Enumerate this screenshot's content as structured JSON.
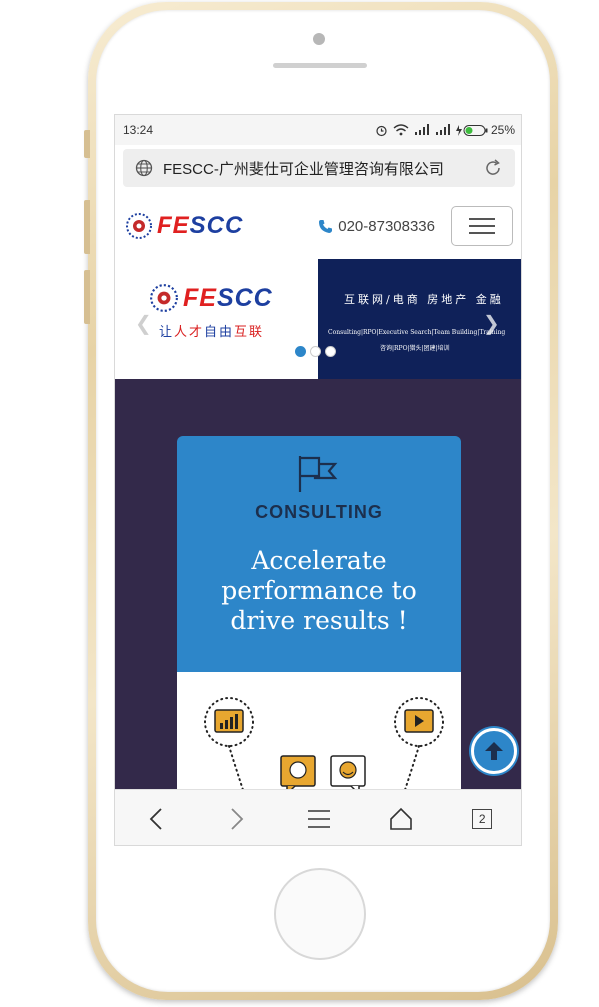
{
  "statusbar": {
    "time": "13:24",
    "battery": "25%"
  },
  "browser": {
    "page_title": "FESCC-广州斐仕可企业管理咨询有限公司",
    "tab_count": "2"
  },
  "header": {
    "logo_text_red": "FE",
    "logo_text_blue": "SCC",
    "phone": "020-87308336"
  },
  "banner": {
    "logo_red": "FE",
    "logo_blue": "SCC",
    "slogan_blue_1": "让",
    "slogan_red_1": "人才",
    "slogan_blue_2": "自由",
    "slogan_red_2": "互联",
    "right_cn": "互联网/电商 房地产 金融",
    "right_en": "Consulting|RPO|Executive Search|Team Building|Training",
    "right_cn_small": "咨询|RPO|猎头|团建|培训",
    "dots": [
      {
        "active": true
      },
      {
        "active": false
      },
      {
        "active": false
      }
    ]
  },
  "card": {
    "label": "CONSULTING",
    "headline_line1": "Accelerate",
    "headline_line2": "performance to",
    "headline_line3": "drive results !"
  },
  "icons": {
    "globe": "globe-icon",
    "refresh": "refresh-icon",
    "phone": "phone-icon",
    "menu": "hamburger-menu-icon",
    "flag": "flag-icon",
    "chart": "bar-chart-icon",
    "play": "play-icon",
    "chat": "chat-bubble-icon",
    "up": "arrow-up-icon"
  },
  "colors": {
    "brand_blue": "#2d86c9",
    "dark_navy": "#0f2159",
    "content_bg": "#33294a",
    "logo_red": "#e02020",
    "logo_blue": "#1d3fa0"
  }
}
